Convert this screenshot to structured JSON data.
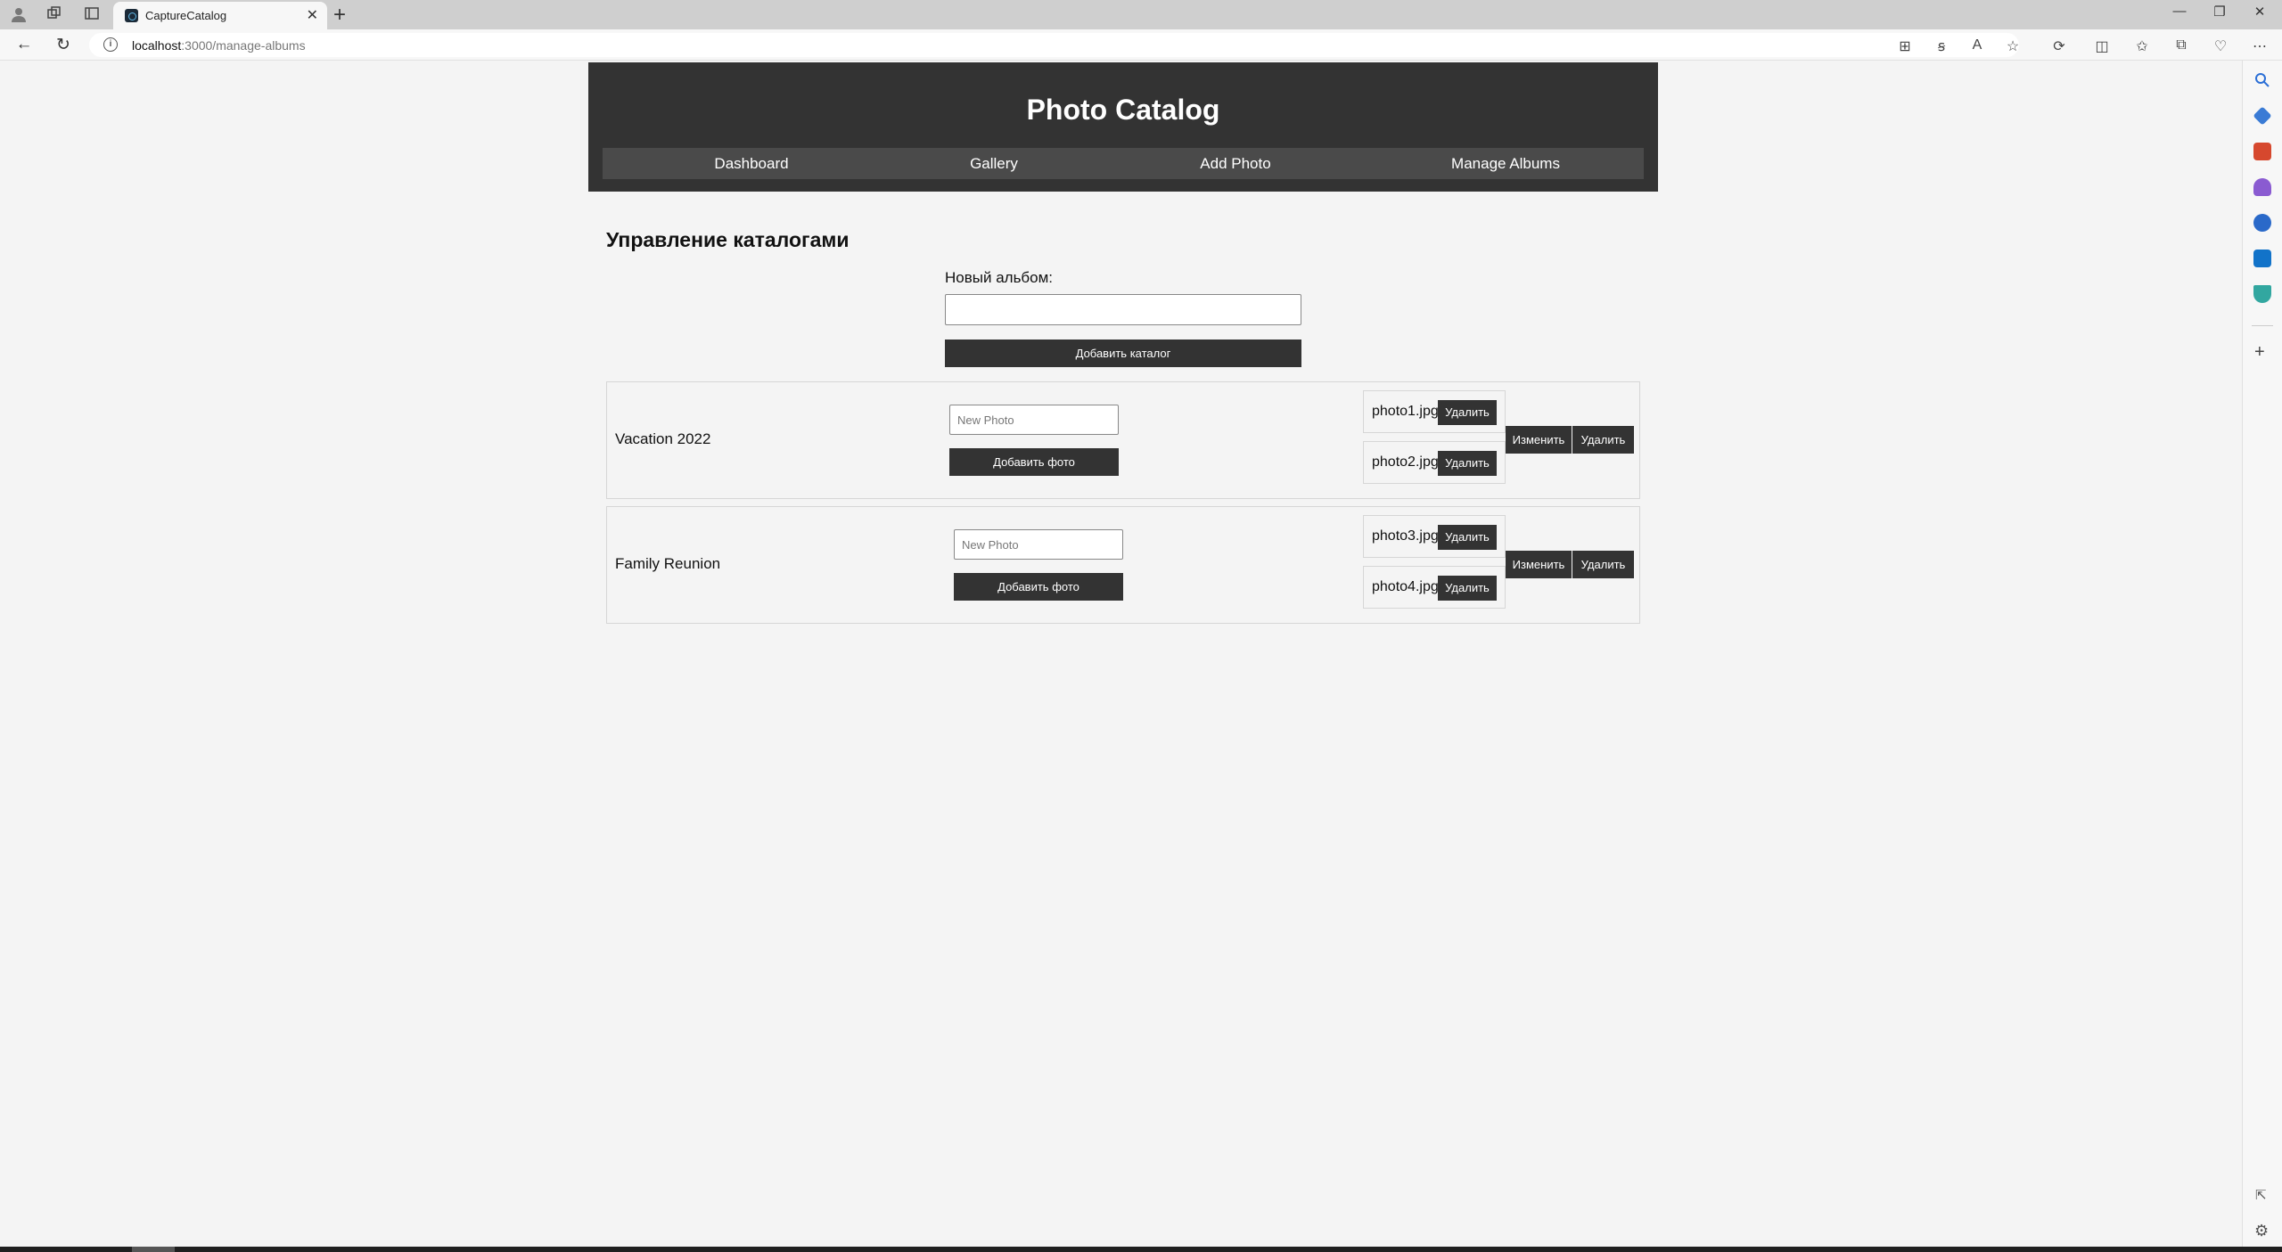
{
  "browser": {
    "tab_title": "CaptureCatalog",
    "url_host": "localhost",
    "url_path": ":3000/manage-albums"
  },
  "site": {
    "title": "Photo Catalog",
    "nav": [
      {
        "label": "Dashboard"
      },
      {
        "label": "Gallery"
      },
      {
        "label": "Add Photo"
      },
      {
        "label": "Manage Albums"
      }
    ]
  },
  "page": {
    "heading": "Управление каталогами",
    "new_album_label": "Новый альбом:",
    "new_album_value": "",
    "add_catalog_label": "Добавить каталог"
  },
  "albums": [
    {
      "name": "Vacation 2022",
      "photo_placeholder": "New Photo",
      "add_photo_label": "Добавить фото",
      "photos": [
        {
          "name": "photo1.jpg",
          "delete_label": "Удалить"
        },
        {
          "name": "photo2.jpg",
          "delete_label": "Удалить"
        }
      ],
      "edit_label": "Изменить",
      "delete_label": "Удалить"
    },
    {
      "name": "Family Reunion",
      "photo_placeholder": "New Photo",
      "add_photo_label": "Добавить фото",
      "photos": [
        {
          "name": "photo3.jpg",
          "delete_label": "Удалить"
        },
        {
          "name": "photo4.jpg",
          "delete_label": "Удалить"
        }
      ],
      "edit_label": "Изменить",
      "delete_label": "Удалить"
    }
  ],
  "colors": {
    "header_bg": "#333333",
    "nav_bg": "#4a4a4a",
    "button_bg": "#333333",
    "page_bg": "#f4f4f4"
  }
}
